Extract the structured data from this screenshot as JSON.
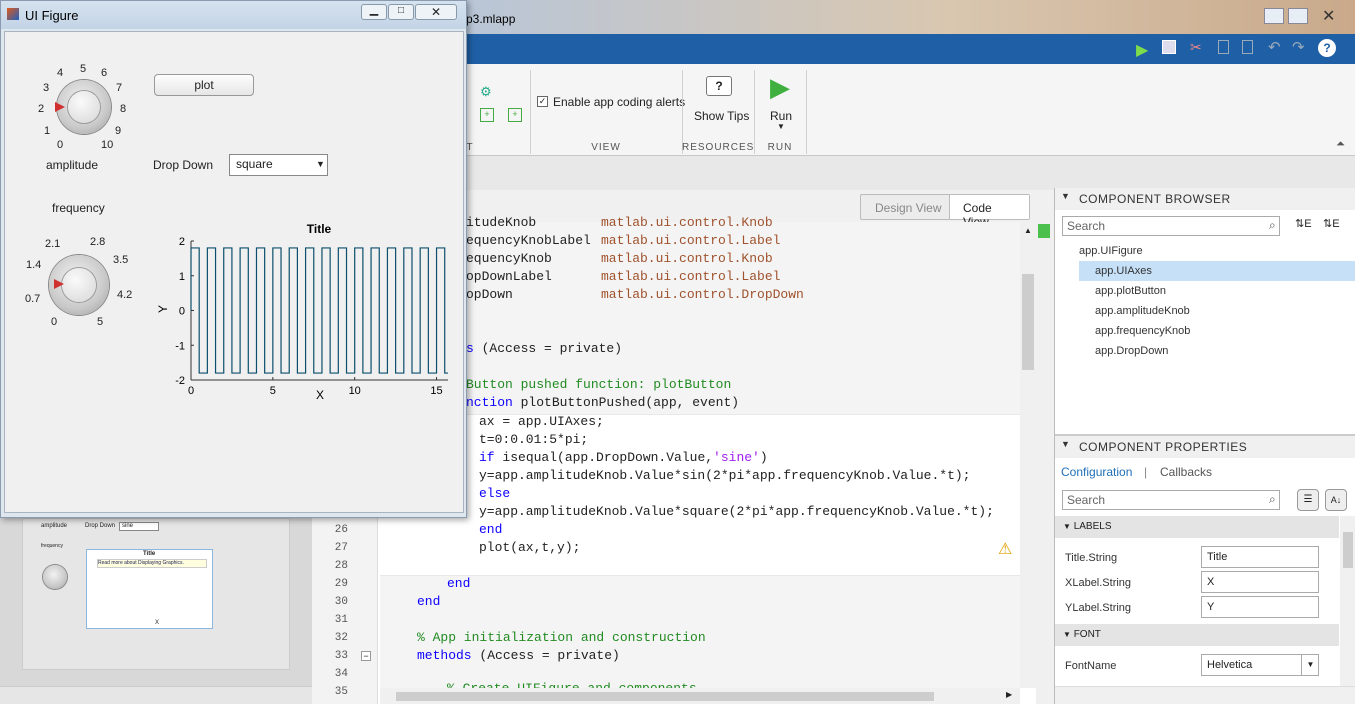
{
  "window_titles": {
    "ui_figure": "UI Figure",
    "app_designer": "p3.mlapp"
  },
  "toolstrip": {
    "enable_alerts_label": "Enable app coding alerts",
    "show_tips_label": "Show Tips",
    "run_label": "Run",
    "groups": [
      "T",
      "VIEW",
      "RESOURCES",
      "RUN"
    ]
  },
  "view_toggle": {
    "design": "Design View",
    "code": "Code View"
  },
  "code_top": [
    {
      "name": "itudeKnob",
      "type": "matlab.ui.control.Knob"
    },
    {
      "name": "equencyKnobLabel",
      "type": "matlab.ui.control.Label"
    },
    {
      "name": "equencyKnob",
      "type": "matlab.ui.control.Knob"
    },
    {
      "name": "opDownLabel",
      "type": "matlab.ui.control.Label"
    },
    {
      "name": "opDown",
      "type": "matlab.ui.control.DropDown"
    }
  ],
  "code": {
    "access1_kw": "s",
    "access1_rest": " (Access = private)",
    "comment1": "Button pushed function: plotButton",
    "func_kw": "nction",
    "func_rest": " plotButtonPushed(app, event)",
    "l1": "ax = app.UIAxes;",
    "l2": "t=0:0.01:5*pi;",
    "l3_kw": "if",
    "l3_a": " isequal(app.DropDown.Value,",
    "l3_str": "'sine'",
    "l3_b": ")",
    "l4": "y=app.amplitudeKnob.Value*sin(2*pi*app.frequencyKnob.Value.*t);",
    "l5": "else",
    "l6": "y=app.amplitudeKnob.Value*square(2*pi*app.frequencyKnob.Value.*t);",
    "l7": "end",
    "l8": "plot(ax,t,y);",
    "end1": "end",
    "end2": "end",
    "comment2": "% App initialization and construction",
    "methods_kw": "methods",
    "methods_rest": " (Access = private)",
    "comment3": "% Create UIFigure and components"
  },
  "line_numbers": [
    "26",
    "27",
    "28",
    "29",
    "30",
    "31",
    "32",
    "33",
    "34",
    "35"
  ],
  "component_browser": {
    "header": "COMPONENT BROWSER",
    "search_placeholder": "Search",
    "root": "app.UIFigure",
    "items": [
      "app.UIAxes",
      "app.plotButton",
      "app.amplitudeKnob",
      "app.frequencyKnob",
      "app.DropDown"
    ],
    "selected_index": 0
  },
  "component_properties": {
    "header": "COMPONENT PROPERTIES",
    "tab_config": "Configuration",
    "tab_callbacks": "Callbacks",
    "search_placeholder": "Search",
    "labels_section": "LABELS",
    "font_section": "FONT",
    "props": [
      {
        "label": "Title.String",
        "value": "Title"
      },
      {
        "label": "XLabel.String",
        "value": "X"
      },
      {
        "label": "YLabel.String",
        "value": "Y"
      }
    ],
    "fontname_label": "FontName",
    "fontname_value": "Helvetica"
  },
  "ui_figure": {
    "amplitude_label": "amplitude",
    "amplitude_ticks": [
      "0",
      "1",
      "2",
      "3",
      "4",
      "5",
      "6",
      "7",
      "8",
      "9",
      "10"
    ],
    "frequency_label": "frequency",
    "frequency_ticks": [
      "0",
      "0.7",
      "1.4",
      "2.1",
      "2.8",
      "3.5",
      "4.2",
      "5"
    ],
    "plot_button": "plot",
    "dropdown_label": "Drop Down",
    "dropdown_value": "square"
  },
  "chart_data": {
    "type": "line",
    "title": "Title",
    "xlabel": "X",
    "ylabel": "Y",
    "xlim": [
      0,
      15.7
    ],
    "ylim": [
      -2,
      2
    ],
    "xticks": [
      "0",
      "5",
      "10",
      "15"
    ],
    "yticks": [
      "2",
      "1",
      "0",
      "-1",
      "-2"
    ],
    "series": [
      {
        "function": "square",
        "amplitude": 1.8,
        "frequency": 1.0,
        "x_start": 0,
        "x_end": 15.7
      }
    ],
    "color": "#0b4f6c"
  },
  "thumbnail": {
    "amplitude": "amplitude",
    "dropdown_label": "Drop Down",
    "dropdown_value": "sine",
    "frequency": "frequency",
    "title": "Title",
    "tooltip": "Read more about Displaying Graphics.",
    "xlabel": "X"
  }
}
